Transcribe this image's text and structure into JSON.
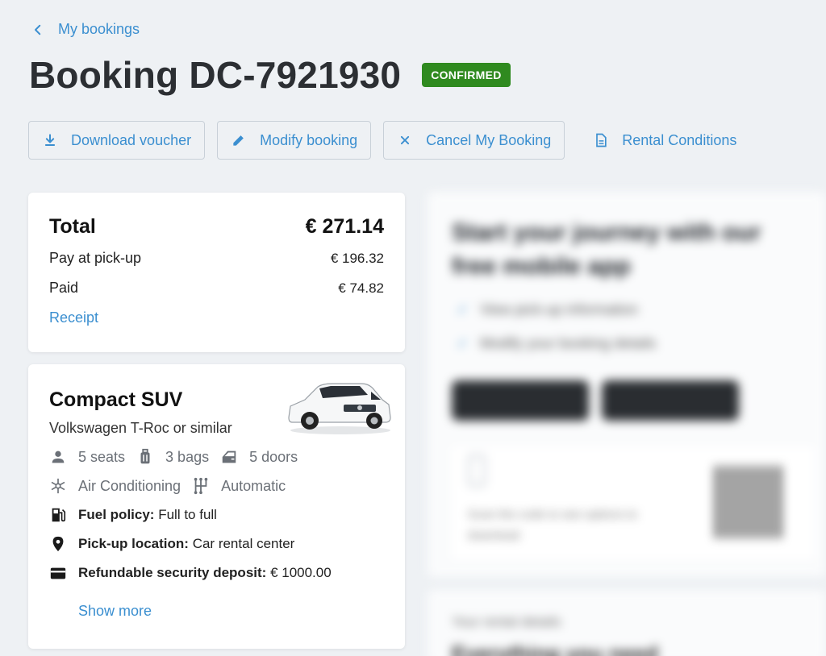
{
  "back": {
    "label": "My bookings"
  },
  "header": {
    "title": "Booking DC-7921930",
    "status": "CONFIRMED"
  },
  "actions": {
    "download": "Download voucher",
    "modify": "Modify booking",
    "cancel": "Cancel My Booking",
    "conditions": "Rental Conditions"
  },
  "payment": {
    "total_label": "Total",
    "total_value": "€ 271.14",
    "pickup_label": "Pay at pick-up",
    "pickup_value": "€ 196.32",
    "paid_label": "Paid",
    "paid_value": "€ 74.82",
    "receipt_link": "Receipt"
  },
  "car": {
    "category": "Compact SUV",
    "model": "Volkswagen T-Roc or similar",
    "seats": "5 seats",
    "bags": "3 bags",
    "doors": "5 doors",
    "ac": "Air Conditioning",
    "transmission": "Automatic",
    "fuel_label": "Fuel policy:",
    "fuel_value": "Full to full",
    "pickup_label": "Pick-up location:",
    "pickup_value": "Car rental center",
    "deposit_label": "Refundable security deposit:",
    "deposit_value": "€ 1000.00",
    "show_more": "Show more"
  },
  "promo": {
    "title": "Start your journey with our free mobile app",
    "check1": "View pick-up information",
    "check2": "Modify your booking details",
    "qr_text": "Scan the code to see options to download",
    "bottom_label": "Your rental details",
    "bottom_title": "Everything you need"
  },
  "colors": {
    "accent": "#3b8fd0",
    "status": "#2f8a1f",
    "background": "#eef1f4"
  }
}
